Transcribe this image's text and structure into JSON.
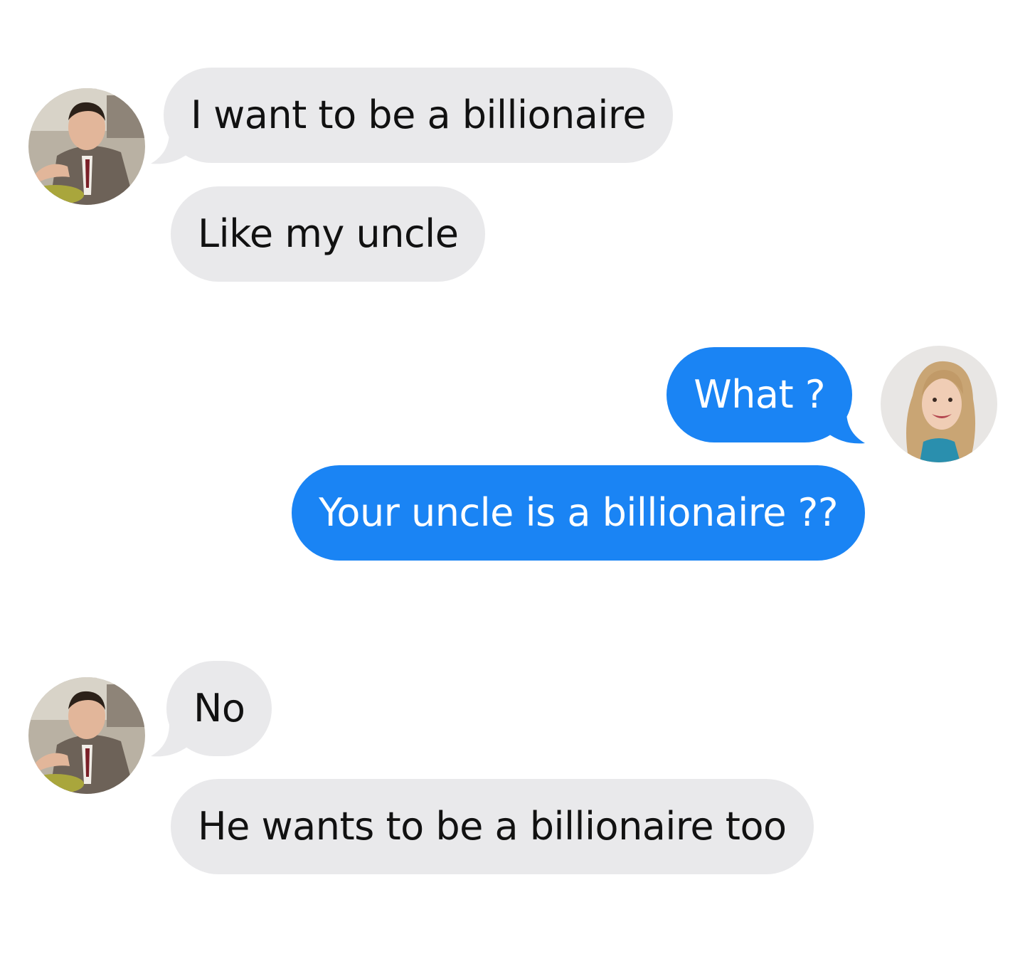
{
  "conversation": {
    "messages": [
      {
        "sender": "them",
        "text": "I want to be a billionaire"
      },
      {
        "sender": "them",
        "text": "Like my uncle"
      },
      {
        "sender": "me",
        "text": "What ?"
      },
      {
        "sender": "me",
        "text": "Your uncle is a billionaire ??"
      },
      {
        "sender": "them",
        "text": "No"
      },
      {
        "sender": "them",
        "text": "He wants to be a billionaire too"
      }
    ]
  },
  "colors": {
    "incoming_bubble": "#e9e9eb",
    "outgoing_bubble": "#1a84f4",
    "incoming_text": "#111111",
    "outgoing_text": "#ffffff"
  },
  "avatars": {
    "them": "man-in-suit-avatar",
    "me": "smiling-blonde-woman-avatar"
  }
}
